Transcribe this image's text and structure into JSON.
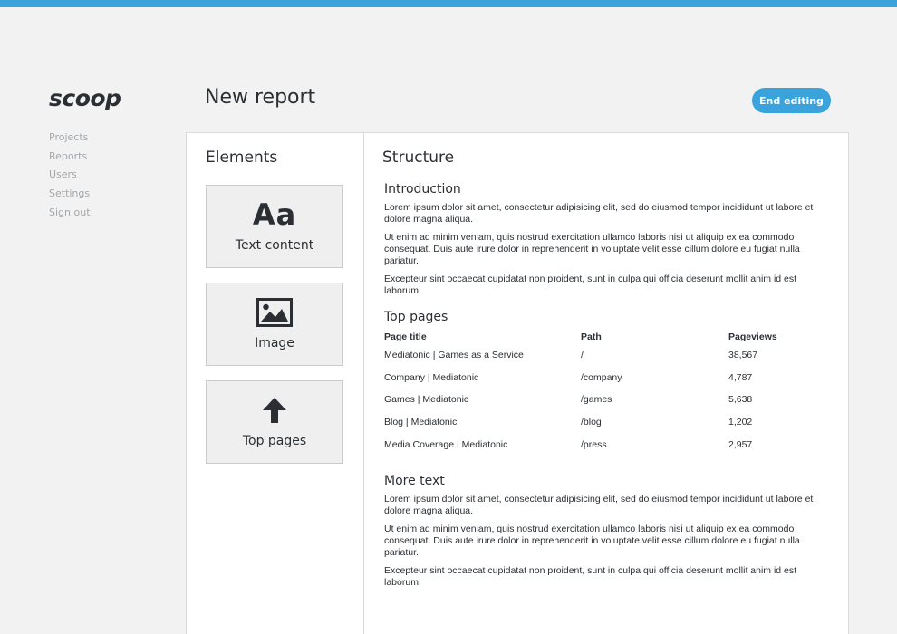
{
  "app": {
    "logo": "scoop"
  },
  "nav": {
    "items": [
      {
        "label": "Projects"
      },
      {
        "label": "Reports"
      },
      {
        "label": "Users"
      },
      {
        "label": "Settings"
      },
      {
        "label": "Sign out"
      }
    ]
  },
  "header": {
    "title": "New report",
    "end_editing_label": "End editing"
  },
  "elements": {
    "heading": "Elements",
    "cards": [
      {
        "icon": "text-aa-icon",
        "glyph": "Aa",
        "label": "Text content"
      },
      {
        "icon": "image-icon",
        "label": "Image"
      },
      {
        "icon": "arrow-up-icon",
        "label": "Top pages"
      }
    ]
  },
  "structure": {
    "heading": "Structure",
    "introduction": {
      "title": "Introduction",
      "paragraphs": [
        "Lorem ipsum dolor sit amet, consectetur adipisicing elit, sed do eiusmod tempor incididunt ut labore et dolore magna aliqua.",
        "Ut enim ad minim veniam, quis nostrud exercitation ullamco laboris nisi ut aliquip ex ea commodo consequat. Duis aute irure dolor in reprehenderit in voluptate velit esse cillum dolore eu fugiat nulla pariatur.",
        "Excepteur sint occaecat cupidatat non proident, sunt in culpa qui officia deserunt mollit anim id est laborum."
      ]
    },
    "top_pages": {
      "title": "Top pages",
      "columns": [
        "Page title",
        "Path",
        "Pageviews"
      ],
      "rows": [
        [
          "Mediatonic | Games as a Service",
          "/",
          "38,567"
        ],
        [
          "Company | Mediatonic",
          "/company",
          "4,787"
        ],
        [
          "Games | Mediatonic",
          "/games",
          "5,638"
        ],
        [
          "Blog | Mediatonic",
          "/blog",
          "1,202"
        ],
        [
          "Media Coverage | Mediatonic",
          "/press",
          "2,957"
        ]
      ]
    },
    "more_text": {
      "title": "More text",
      "paragraphs": [
        "Lorem ipsum dolor sit amet, consectetur adipisicing elit, sed do eiusmod tempor incididunt ut labore et dolore magna aliqua.",
        "Ut enim ad minim veniam, quis nostrud exercitation ullamco laboris nisi ut aliquip ex ea commodo consequat. Duis aute irure dolor in reprehenderit in voluptate velit esse cillum dolore eu fugiat nulla pariatur.",
        "Excepteur sint occaecat cupidatat non proident, sunt in culpa qui officia deserunt mollit anim id est laborum."
      ]
    }
  },
  "colors": {
    "accent": "#3aa3dc",
    "background": "#f2f2f2",
    "text": "#2b2f33",
    "muted": "#a3a7ab"
  }
}
